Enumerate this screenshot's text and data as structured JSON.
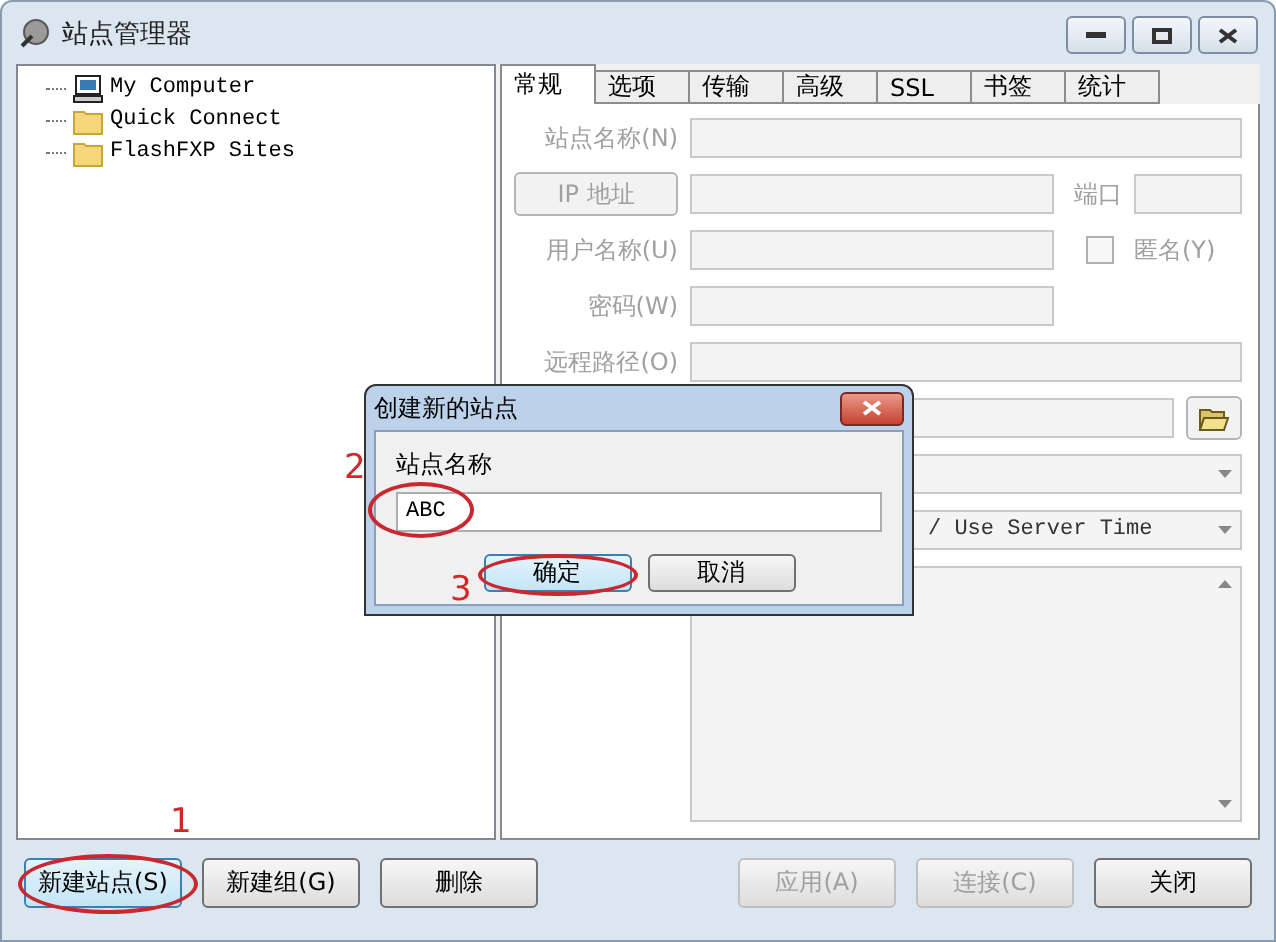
{
  "window": {
    "title": "站点管理器"
  },
  "tree": [
    {
      "label": "My Computer",
      "kind": "computer"
    },
    {
      "label": "Quick Connect",
      "kind": "folder"
    },
    {
      "label": "FlashFXP Sites",
      "kind": "folder"
    }
  ],
  "tabs": [
    {
      "label": "常规",
      "selected": true
    },
    {
      "label": "选项",
      "selected": false
    },
    {
      "label": "传输",
      "selected": false
    },
    {
      "label": "高级",
      "selected": false
    },
    {
      "label": "SSL",
      "selected": false
    },
    {
      "label": "书签",
      "selected": false
    },
    {
      "label": "统计",
      "selected": false
    }
  ],
  "form": {
    "disabled": true,
    "site_name_label": "站点名称(N)",
    "ip_button": "IP 地址",
    "port_label": "端口",
    "user_label": "用户名称(U)",
    "anonymous": {
      "label": "匿名(Y)",
      "checked": false
    },
    "password_label": "密码(W)",
    "remote_path_label": "远程路径(O)",
    "time_option": "/ Use Server Time"
  },
  "dialog": {
    "title": "创建新的站点",
    "label": "站点名称",
    "value": "ABC",
    "buttons": [
      {
        "label": "确定",
        "default": true
      },
      {
        "label": "取消",
        "default": false
      }
    ]
  },
  "buttons": {
    "left": [
      {
        "label": "新建站点(S)",
        "disabled": false,
        "default": true
      },
      {
        "label": "新建组(G)",
        "disabled": false,
        "default": false
      },
      {
        "label": "删除",
        "disabled": false,
        "default": false
      }
    ],
    "right": [
      {
        "label": "应用(A)",
        "disabled": true,
        "default": false
      },
      {
        "label": "连接(C)",
        "disabled": true,
        "default": false
      },
      {
        "label": "关闭",
        "disabled": false,
        "default": false
      }
    ]
  },
  "annotations": [
    {
      "label": "1"
    },
    {
      "label": "2"
    },
    {
      "label": "3"
    }
  ]
}
